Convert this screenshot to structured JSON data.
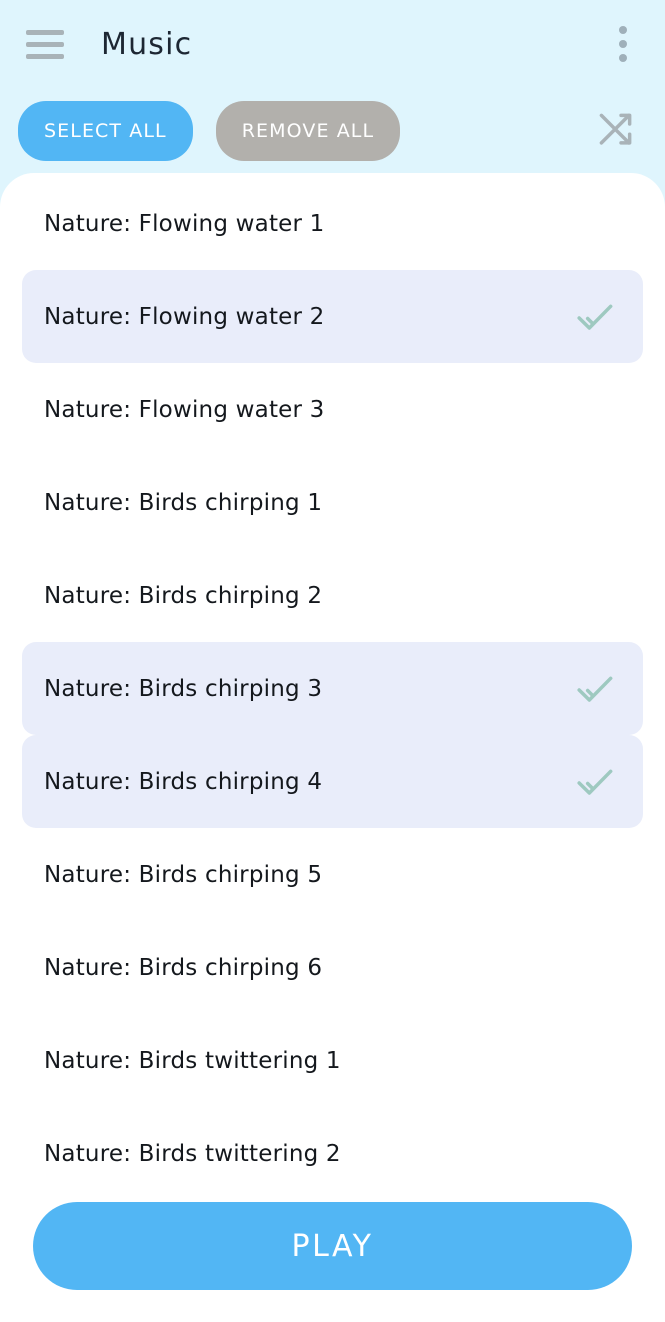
{
  "appbar": {
    "menu_icon": "hamburger-menu-icon",
    "title": "Music",
    "overflow_icon": "more-vertical-icon"
  },
  "actions": {
    "select_all_label": "SELECT ALL",
    "remove_all_label": "REMOVE ALL",
    "shuffle_icon": "shuffle-icon"
  },
  "list": {
    "items": [
      {
        "label": "Nature: Flowing water 1",
        "selected": false
      },
      {
        "label": "Nature: Flowing water 2",
        "selected": true
      },
      {
        "label": "Nature: Flowing water 3",
        "selected": false
      },
      {
        "label": "Nature: Birds chirping 1",
        "selected": false
      },
      {
        "label": "Nature: Birds chirping 2",
        "selected": false
      },
      {
        "label": "Nature: Birds chirping 3",
        "selected": true
      },
      {
        "label": "Nature: Birds chirping 4",
        "selected": true
      },
      {
        "label": "Nature: Birds chirping 5",
        "selected": false
      },
      {
        "label": "Nature: Birds chirping 6",
        "selected": false
      },
      {
        "label": "Nature: Birds twittering 1",
        "selected": false
      },
      {
        "label": "Nature: Birds twittering 2",
        "selected": false
      }
    ],
    "check_icon": "check-icon"
  },
  "footer": {
    "play_label": "PLAY"
  },
  "colors": {
    "background": "#dff5fd",
    "sheet": "#ffffff",
    "accent": "#52b6f4",
    "remove": "#b2b0ac",
    "selected_row": "#e9edfa",
    "check": "#9ec9c0",
    "icon_grey": "#a9b3b8",
    "text": "#14181d"
  }
}
